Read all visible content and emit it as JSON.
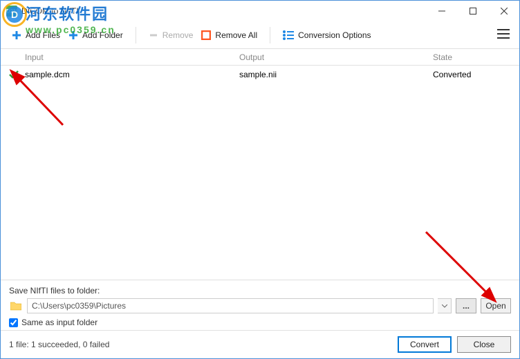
{
  "window": {
    "title": "DICOM to NIfTI",
    "app_icon_text": "D2N"
  },
  "toolbar": {
    "add_files": "Add Files",
    "add_folder": "Add Folder",
    "remove": "Remove",
    "remove_all": "Remove All",
    "conversion_options": "Conversion Options"
  },
  "columns": {
    "input": "Input",
    "output": "Output",
    "state": "State"
  },
  "rows": [
    {
      "input": "sample.dcm",
      "output": "sample.nii",
      "state": "Converted"
    }
  ],
  "save_panel": {
    "label": "Save NIfTI files to folder:",
    "path": "C:\\Users\\pc0359\\Pictures",
    "browse": "...",
    "open": "Open",
    "same_as_input": "Same as input folder",
    "same_checked": true
  },
  "footer": {
    "status": "1 file: 1 succeeded, 0 failed",
    "convert": "Convert",
    "close": "Close"
  },
  "watermark": {
    "site_cn": "河东软件园",
    "url": "www.pc0359.cn"
  }
}
